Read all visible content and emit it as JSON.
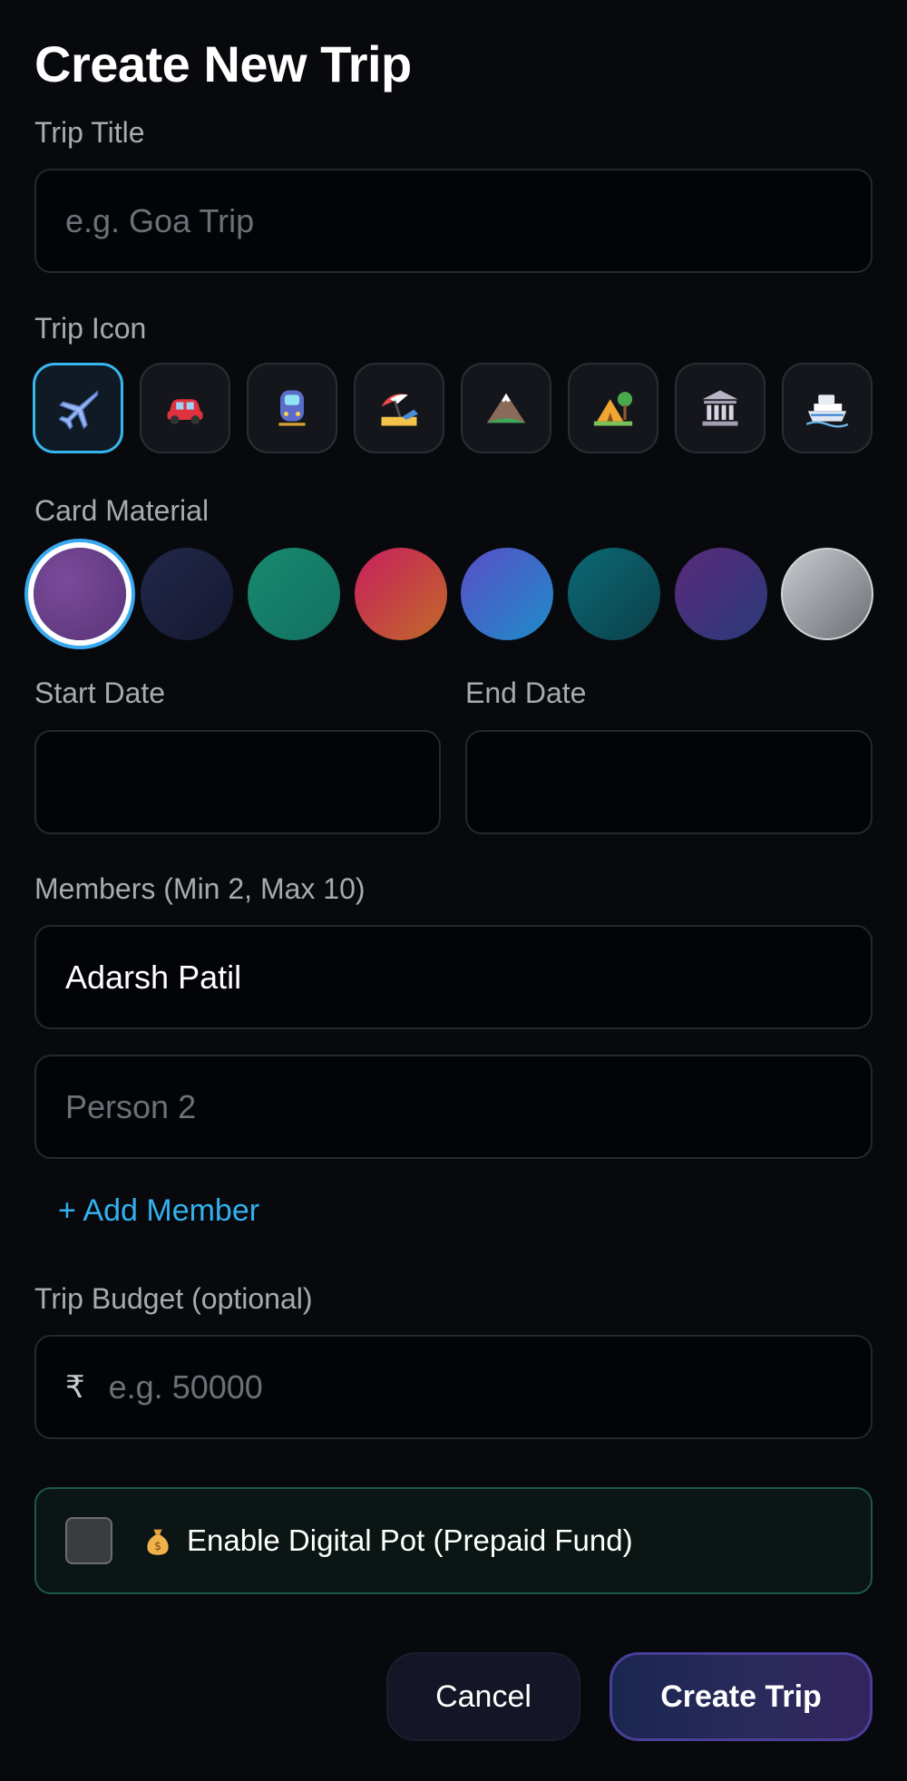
{
  "page": {
    "title": "Create New Trip"
  },
  "trip_title": {
    "label": "Trip Title",
    "placeholder": "e.g. Goa Trip",
    "value": ""
  },
  "trip_icon": {
    "label": "Trip Icon",
    "icons": [
      "airplane-icon",
      "car-icon",
      "train-icon",
      "beach-umbrella-icon",
      "mountain-icon",
      "camping-icon",
      "classical-building-icon",
      "ship-icon"
    ],
    "selected_index": 0
  },
  "card_material": {
    "label": "Card Material",
    "swatches": [
      "#6a3f8a",
      "#1b1f3a",
      "#167d68",
      "#c2305a",
      "#4a63c8",
      "#0f5a63",
      "#4a2a7a",
      "#a5a8ad"
    ],
    "selected_index": 0
  },
  "start_date": {
    "label": "Start Date",
    "value": ""
  },
  "end_date": {
    "label": "End Date",
    "value": ""
  },
  "members": {
    "label": "Members (Min 2, Max 10)",
    "items": [
      {
        "value": "Adarsh Patil",
        "placeholder": ""
      },
      {
        "value": "",
        "placeholder": "Person 2"
      }
    ],
    "add_label": "+ Add Member"
  },
  "budget": {
    "label": "Trip Budget",
    "label_suffix": "(optional)",
    "currency_symbol": "₹",
    "placeholder": "e.g. 50000",
    "value": ""
  },
  "digital_pot": {
    "checked": false,
    "label": "Enable Digital Pot (Prepaid Fund)",
    "icon": "money-bag-icon"
  },
  "actions": {
    "cancel_label": "Cancel",
    "create_label": "Create Trip"
  },
  "colors": {
    "accent": "#37b6ee",
    "background": "#07090d",
    "pot_border": "#1c5a48"
  }
}
